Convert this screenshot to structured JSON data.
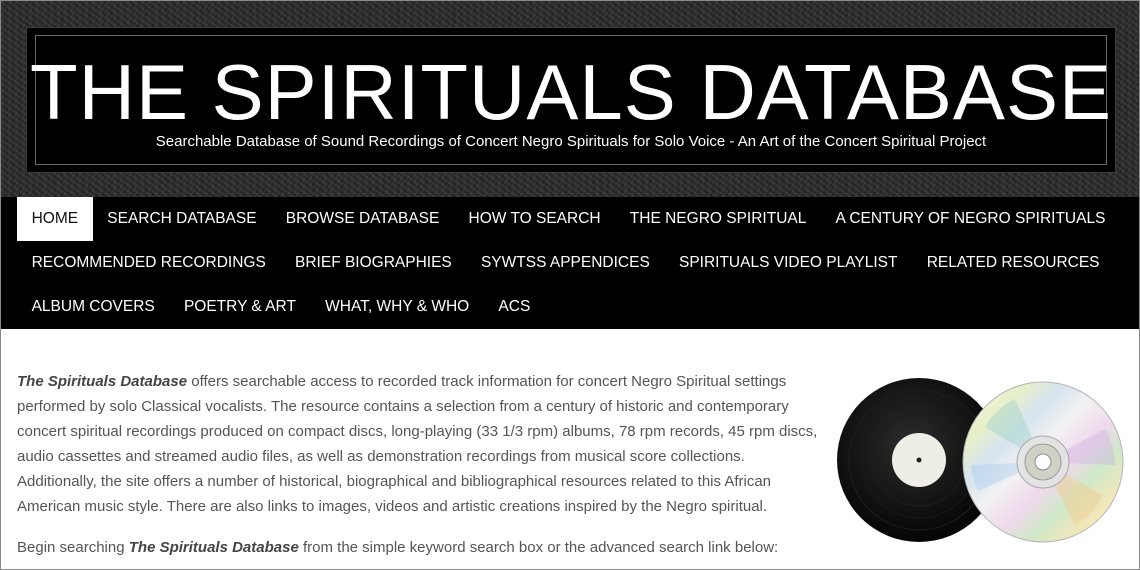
{
  "header": {
    "title": "THE SPIRITUALS DATABASE",
    "subtitle": "Searchable Database of Sound Recordings of Concert Negro Spirituals for Solo Voice - An Art of the Concert Spiritual Project"
  },
  "nav": {
    "rows": [
      [
        "HOME",
        "SEARCH DATABASE",
        "BROWSE DATABASE",
        "HOW TO SEARCH",
        "THE NEGRO SPIRITUAL",
        "A CENTURY OF NEGRO SPIRITUALS"
      ],
      [
        "RECOMMENDED RECORDINGS",
        "BRIEF BIOGRAPHIES",
        "SYWTSS APPENDICES",
        "SPIRITUALS VIDEO PLAYLIST",
        "RELATED RESOURCES"
      ],
      [
        "ALBUM COVERS",
        "POETRY & ART",
        "WHAT, WHY & WHO",
        "ACS"
      ]
    ],
    "active": "HOME"
  },
  "content": {
    "intro_title": "The Spirituals Database",
    "intro_text": " offers searchable access to recorded track information for concert Negro Spiritual settings performed by solo Classical vocalists. The resource contains a selection from a century of historic and contemporary concert spiritual recordings produced on compact discs, long-playing (33 1/3 rpm) albums, 78 rpm records, 45 rpm discs, audio cassettes and streamed audio files, as well as demonstration recordings from musical score collections. Additionally, the site offers a number of historical, biographical and bibliographical resources related to this African American music style. There are also links to images, videos and artistic creations inspired by the Negro spiritual.",
    "search_prefix": "Begin searching ",
    "search_title": "The Spirituals Database",
    "search_suffix": " from the simple keyword search box or the advanced search link below:"
  },
  "colors": {
    "nav_bg": "#000000",
    "nav_text": "#ffffff",
    "active_bg": "#ffffff",
    "body_text": "#555555"
  },
  "icons": [
    "vinyl-record-icon",
    "compact-disc-icon"
  ]
}
